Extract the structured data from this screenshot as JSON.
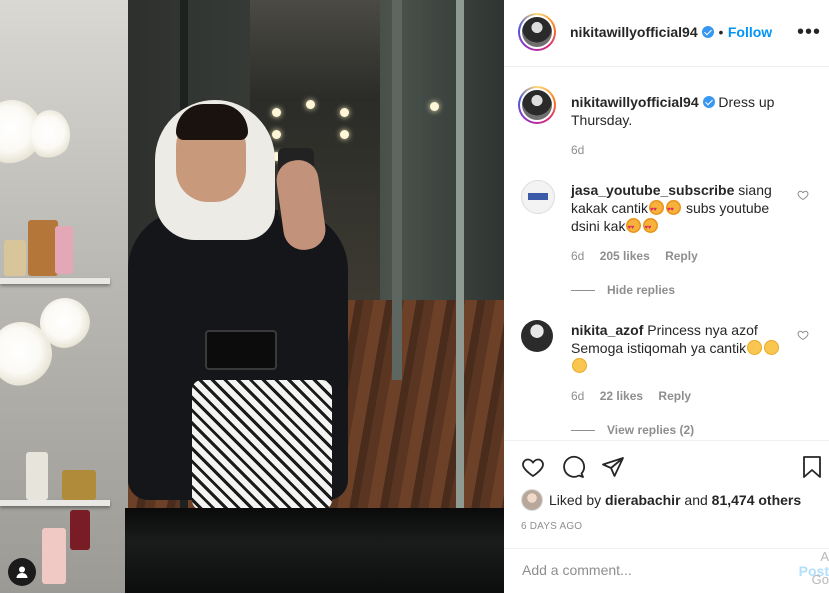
{
  "post": {
    "username": "nikitawillyofficial94",
    "follow_label": "Follow",
    "separator": "•",
    "more_icon": "more-horizontal-icon",
    "caption_user": "nikitawillyofficial94",
    "caption_text": "Dress up Thursday.",
    "caption_age": "6d"
  },
  "comments": [
    {
      "username": "jasa_youtube_subscribe",
      "text_before": "siang kakak cantik",
      "text_mid": "subs youtube dsini kak",
      "age": "6d",
      "likes": "205 likes",
      "reply_label": "Reply",
      "thread_toggle": "Hide replies"
    },
    {
      "username": "nikita_azof",
      "text_before": "Princess nya azof Semoga istiqomah ya cantik",
      "age": "6d",
      "likes": "22 likes",
      "reply_label": "Reply",
      "thread_toggle": "View replies (2)"
    }
  ],
  "actions": {
    "liked_prefix": "Liked by",
    "liked_user": "dierabachir",
    "liked_and": "and",
    "liked_count": "81,474 others",
    "date": "6 DAYS AGO"
  },
  "add_comment": {
    "placeholder": "Add a comment...",
    "post_label": "Post"
  },
  "edge": {
    "line1": "A",
    "line2": "Go"
  },
  "colors": {
    "link": "#0095f6",
    "verified": "#3897f0",
    "muted": "#8e8e8e"
  }
}
